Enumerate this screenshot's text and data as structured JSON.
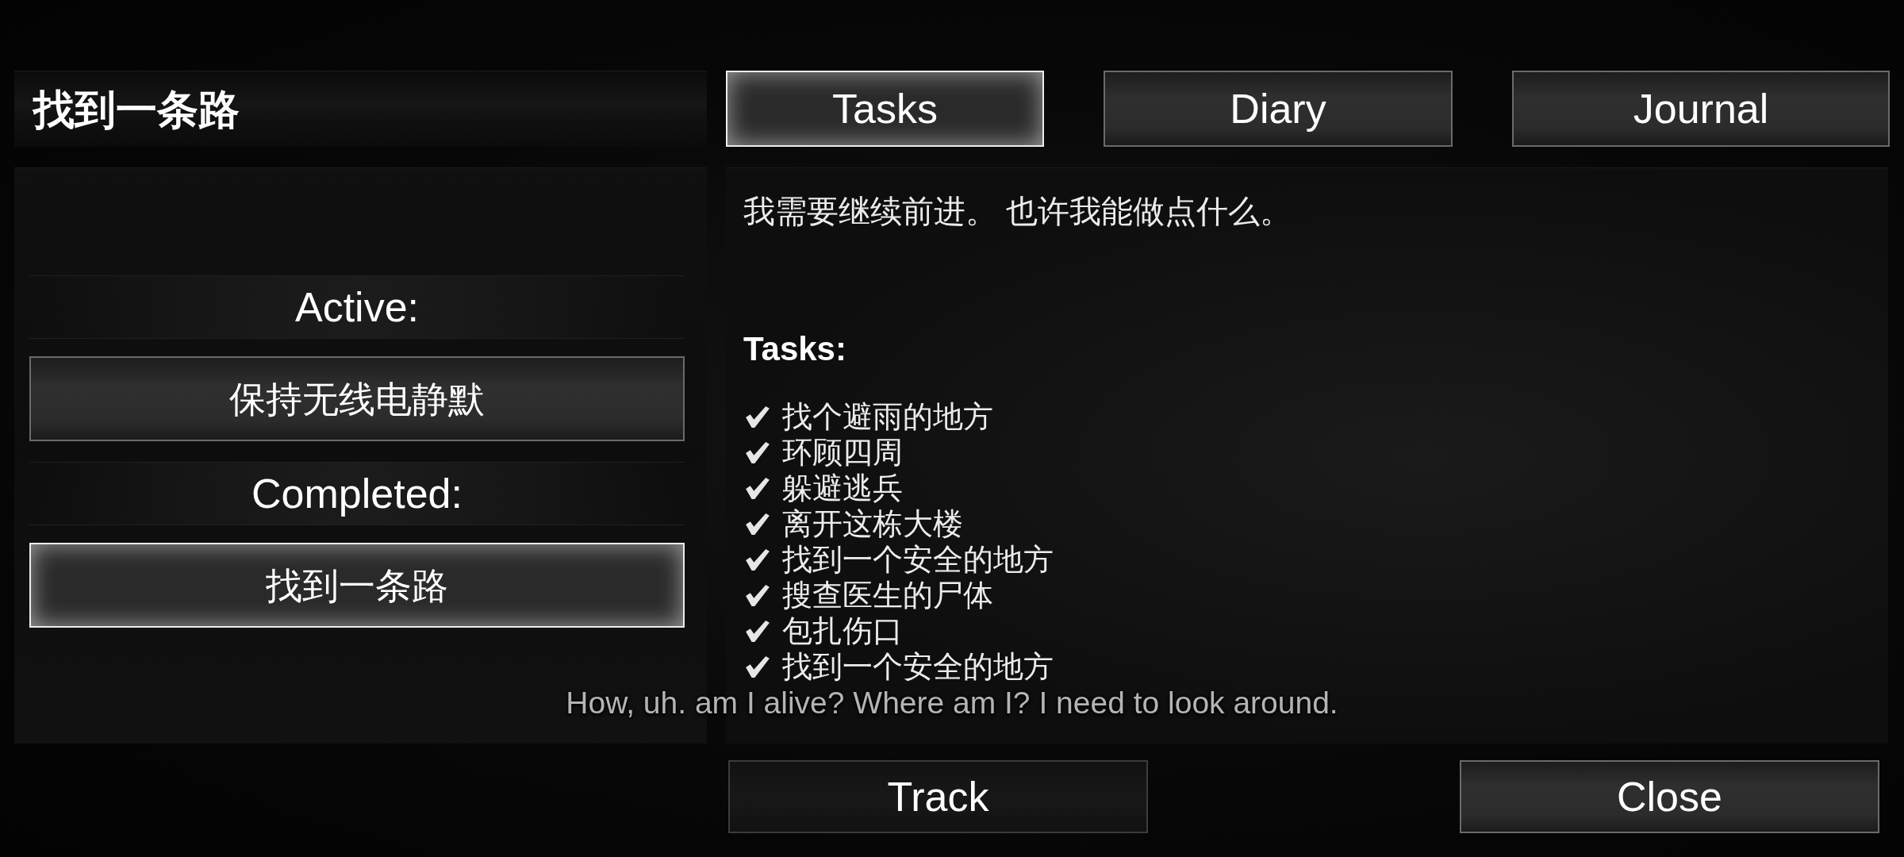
{
  "quest_title": "找到一条路",
  "tabs": [
    {
      "label": "Tasks",
      "selected": true
    },
    {
      "label": "Diary",
      "selected": false
    },
    {
      "label": "Journal",
      "selected": false
    }
  ],
  "quest_list": {
    "sections": [
      {
        "heading": "Active:",
        "items": [
          {
            "label": "保持无线电静默",
            "selected": false
          }
        ]
      },
      {
        "heading": "Completed:",
        "items": [
          {
            "label": "找到一条路",
            "selected": true
          }
        ]
      }
    ]
  },
  "details": {
    "description": "我需要继续前进。 也许我能做点什么。",
    "tasks_heading": "Tasks:",
    "tasks": [
      {
        "label": "找个避雨的地方",
        "checked": true
      },
      {
        "label": "环顾四周",
        "checked": true
      },
      {
        "label": "躲避逃兵",
        "checked": true
      },
      {
        "label": "离开这栋大楼",
        "checked": true
      },
      {
        "label": "找到一个安全的地方",
        "checked": true
      },
      {
        "label": "搜查医生的尸体",
        "checked": true
      },
      {
        "label": "包扎伤口",
        "checked": true
      },
      {
        "label": "找到一个安全的地方",
        "checked": true
      }
    ]
  },
  "subtitle": "How, uh. am I alive? Where am I? I need to look around.",
  "buttons": [
    {
      "label": "Track",
      "disabled": true
    },
    {
      "label": "Close",
      "disabled": false
    }
  ]
}
